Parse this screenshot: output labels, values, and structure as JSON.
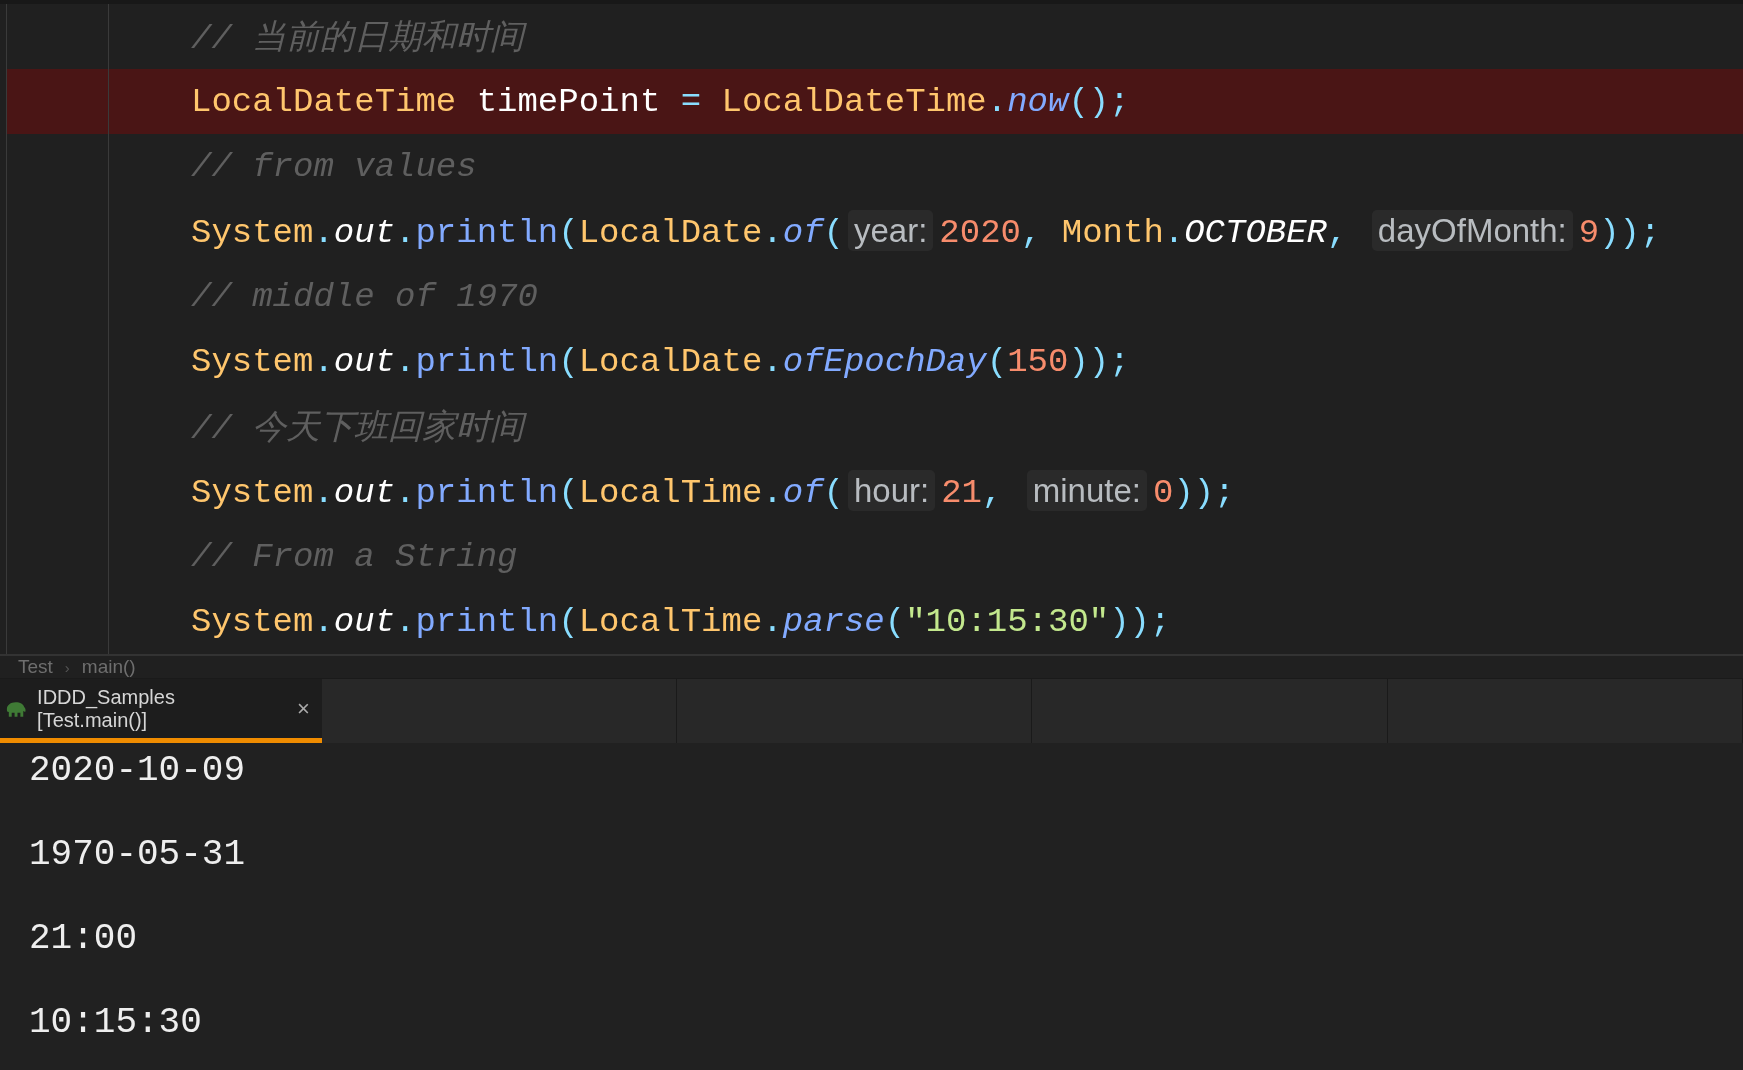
{
  "editor": {
    "lines": [
      {
        "highlighted": false,
        "tokens": [
          {
            "kind": "comment",
            "text": "// 当前的日期和时间"
          }
        ]
      },
      {
        "highlighted": true,
        "tokens": [
          {
            "kind": "type",
            "text": "LocalDateTime"
          },
          {
            "kind": "var",
            "text": " timePoint "
          },
          {
            "kind": "punct",
            "text": "= "
          },
          {
            "kind": "type",
            "text": "LocalDateTime"
          },
          {
            "kind": "punct",
            "text": "."
          },
          {
            "kind": "method",
            "text": "now"
          },
          {
            "kind": "punct",
            "text": "();"
          }
        ]
      },
      {
        "highlighted": false,
        "tokens": [
          {
            "kind": "comment",
            "text": "// from values"
          }
        ]
      },
      {
        "highlighted": false,
        "tokens": [
          {
            "kind": "type",
            "text": "System"
          },
          {
            "kind": "punct",
            "text": "."
          },
          {
            "kind": "static",
            "text": "out"
          },
          {
            "kind": "punct",
            "text": "."
          },
          {
            "kind": "call",
            "text": "println"
          },
          {
            "kind": "punct",
            "text": "("
          },
          {
            "kind": "type",
            "text": "LocalDate"
          },
          {
            "kind": "punct",
            "text": "."
          },
          {
            "kind": "method",
            "text": "of"
          },
          {
            "kind": "punct",
            "text": "("
          },
          {
            "kind": "hint",
            "text": "year:"
          },
          {
            "kind": "number",
            "text": "2020"
          },
          {
            "kind": "punct",
            "text": ", "
          },
          {
            "kind": "type",
            "text": "Month"
          },
          {
            "kind": "punct",
            "text": "."
          },
          {
            "kind": "static",
            "text": "OCTOBER"
          },
          {
            "kind": "punct",
            "text": ", "
          },
          {
            "kind": "hint",
            "text": "dayOfMonth:"
          },
          {
            "kind": "number",
            "text": "9"
          },
          {
            "kind": "punct",
            "text": "));"
          }
        ]
      },
      {
        "highlighted": false,
        "tokens": [
          {
            "kind": "comment",
            "text": "// middle of 1970"
          }
        ]
      },
      {
        "highlighted": false,
        "tokens": [
          {
            "kind": "type",
            "text": "System"
          },
          {
            "kind": "punct",
            "text": "."
          },
          {
            "kind": "static",
            "text": "out"
          },
          {
            "kind": "punct",
            "text": "."
          },
          {
            "kind": "call",
            "text": "println"
          },
          {
            "kind": "punct",
            "text": "("
          },
          {
            "kind": "type",
            "text": "LocalDate"
          },
          {
            "kind": "punct",
            "text": "."
          },
          {
            "kind": "method",
            "text": "ofEpochDay"
          },
          {
            "kind": "punct",
            "text": "("
          },
          {
            "kind": "number",
            "text": "150"
          },
          {
            "kind": "punct",
            "text": "));"
          }
        ]
      },
      {
        "highlighted": false,
        "tokens": [
          {
            "kind": "comment",
            "text": "// 今天下班回家时间"
          }
        ]
      },
      {
        "highlighted": false,
        "tokens": [
          {
            "kind": "type",
            "text": "System"
          },
          {
            "kind": "punct",
            "text": "."
          },
          {
            "kind": "static",
            "text": "out"
          },
          {
            "kind": "punct",
            "text": "."
          },
          {
            "kind": "call",
            "text": "println"
          },
          {
            "kind": "punct",
            "text": "("
          },
          {
            "kind": "type",
            "text": "LocalTime"
          },
          {
            "kind": "punct",
            "text": "."
          },
          {
            "kind": "method",
            "text": "of"
          },
          {
            "kind": "punct",
            "text": "("
          },
          {
            "kind": "hint",
            "text": "hour:"
          },
          {
            "kind": "number",
            "text": "21"
          },
          {
            "kind": "punct",
            "text": ", "
          },
          {
            "kind": "hint",
            "text": "minute:"
          },
          {
            "kind": "number",
            "text": "0"
          },
          {
            "kind": "punct",
            "text": "));"
          }
        ]
      },
      {
        "highlighted": false,
        "tokens": [
          {
            "kind": "comment",
            "text": "// From a String"
          }
        ]
      },
      {
        "highlighted": false,
        "tokens": [
          {
            "kind": "type",
            "text": "System"
          },
          {
            "kind": "punct",
            "text": "."
          },
          {
            "kind": "static",
            "text": "out"
          },
          {
            "kind": "punct",
            "text": "."
          },
          {
            "kind": "call",
            "text": "println"
          },
          {
            "kind": "punct",
            "text": "("
          },
          {
            "kind": "type",
            "text": "LocalTime"
          },
          {
            "kind": "punct",
            "text": "."
          },
          {
            "kind": "method",
            "text": "parse"
          },
          {
            "kind": "punct",
            "text": "("
          },
          {
            "kind": "string",
            "text": "\"10:15:30\""
          },
          {
            "kind": "punct",
            "text": "));"
          }
        ]
      }
    ]
  },
  "breadcrumbs": {
    "items": [
      "Test",
      "main()"
    ],
    "separator": "›"
  },
  "run_tabs": [
    {
      "label": "IDDD_Samples [Test.main()]",
      "close": "×",
      "selected": true
    }
  ],
  "console_output": [
    "2020-10-09",
    "1970-05-31",
    "21:00",
    "10:15:30"
  ]
}
